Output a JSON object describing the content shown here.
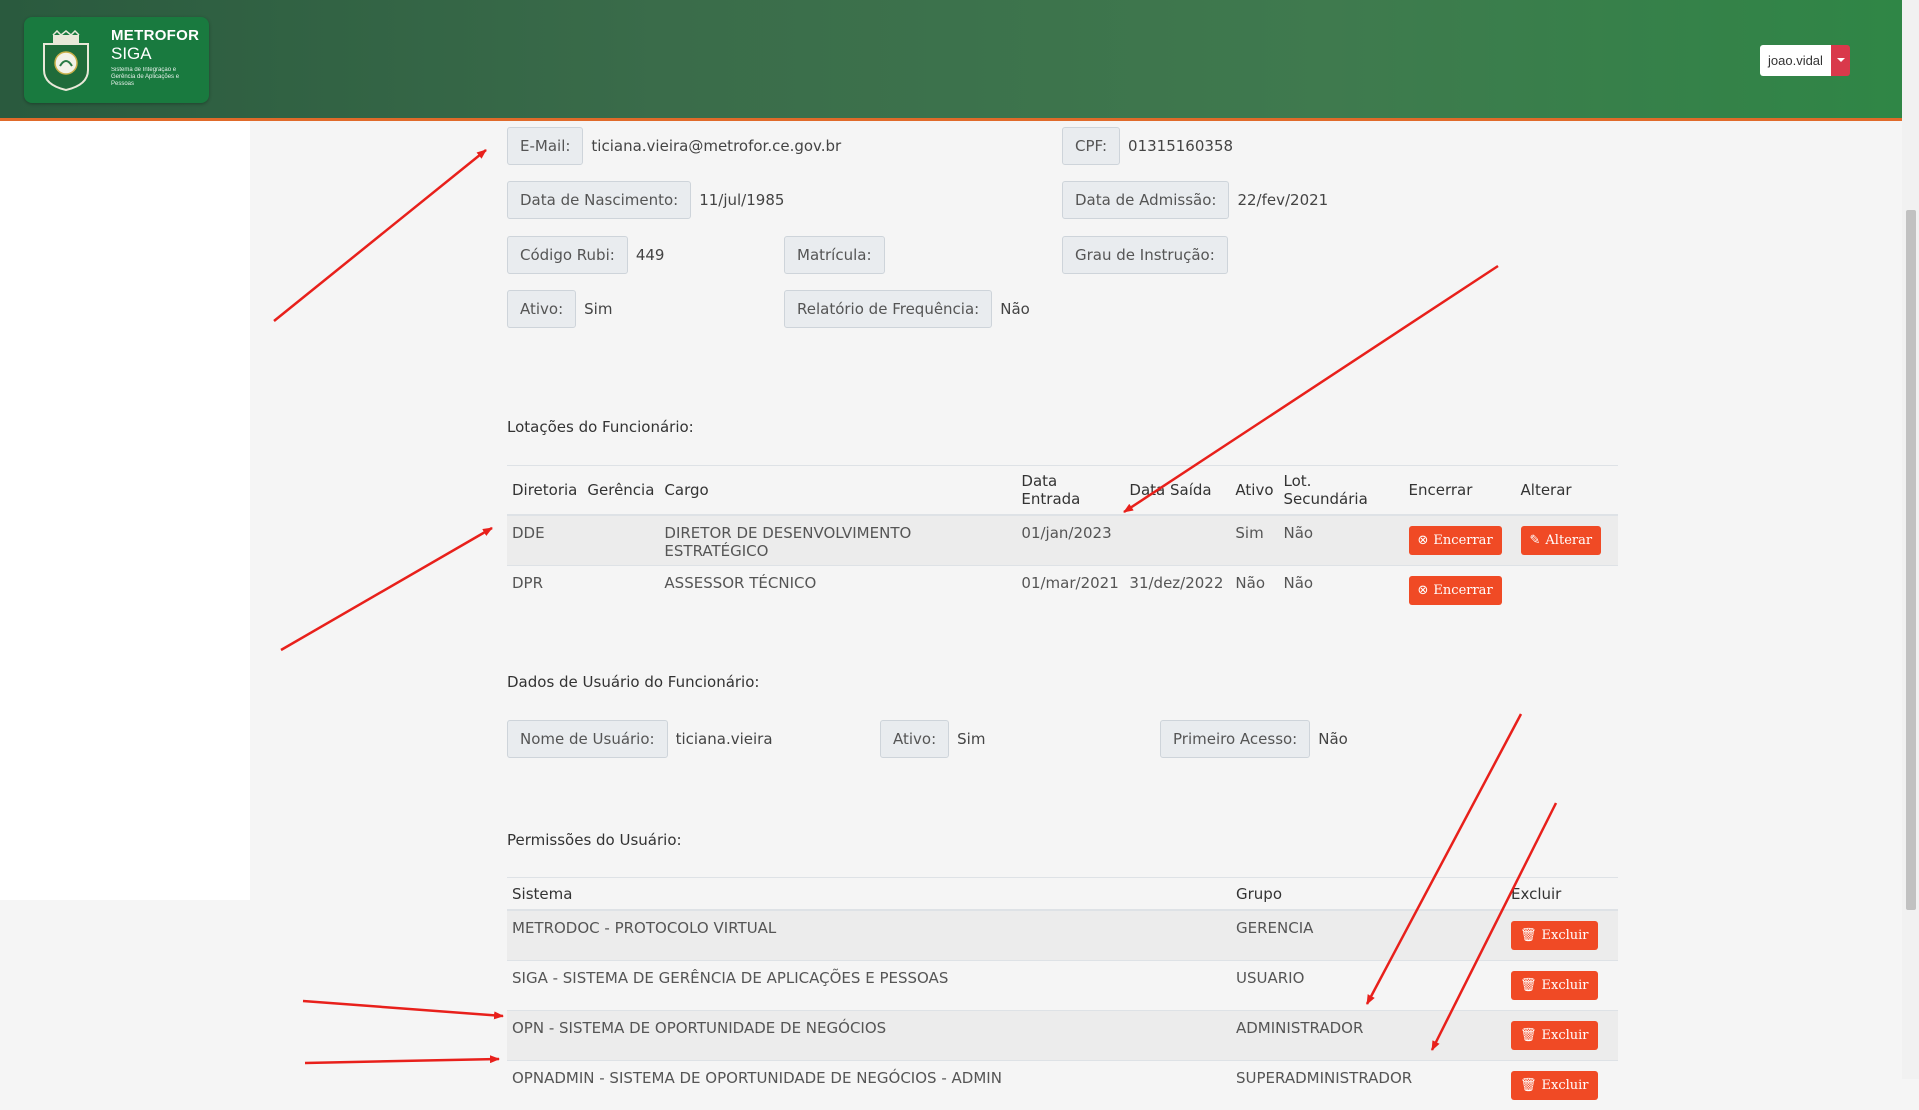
{
  "header": {
    "brand_title": "METROFOR",
    "brand_subtitle": "SIGA",
    "brand_tagline": "Sistema de Integração e Gerência de Aplicações e Pessoas",
    "user": "joao.vidal"
  },
  "profile": {
    "email_label": "E-Mail:",
    "email_value": "ticiana.vieira@metrofor.ce.gov.br",
    "cpf_label": "CPF:",
    "cpf_value": "01315160358",
    "birth_label": "Data de Nascimento:",
    "birth_value": "11/jul/1985",
    "admission_label": "Data de Admissão:",
    "admission_value": "22/fev/2021",
    "rubi_label": "Código Rubi:",
    "rubi_value": "449",
    "matricula_label": "Matrícula:",
    "instrucao_label": "Grau de Instrução:",
    "ativo_label": "Ativo:",
    "ativo_value": "Sim",
    "freq_label": "Relatório de Frequência:",
    "freq_value": "Não"
  },
  "lotacoes": {
    "title": "Lotações do Funcionário:",
    "headers": [
      "Diretoria",
      "Gerência",
      "Cargo",
      "Data Entrada",
      "Data Saída",
      "Ativo",
      "Lot. Secundária",
      "Encerrar",
      "Alterar"
    ],
    "rows": [
      {
        "diretoria": "DDE",
        "gerencia": "",
        "cargo": "DIRETOR DE DESENVOLVIMENTO ESTRATÉGICO",
        "entrada": "01/jan/2023",
        "saida": "",
        "ativo": "Sim",
        "secundaria": "Não",
        "encerrar": "Encerrar",
        "alterar": "Alterar"
      },
      {
        "diretoria": "DPR",
        "gerencia": "",
        "cargo": "ASSESSOR TÉCNICO",
        "entrada": "01/mar/2021",
        "saida": "31/dez/2022",
        "ativo": "Não",
        "secundaria": "Não",
        "encerrar": "Encerrar"
      }
    ]
  },
  "usuario": {
    "title": "Dados de Usuário do Funcionário:",
    "nome_label": "Nome de Usuário:",
    "nome_value": "ticiana.vieira",
    "ativo_label": "Ativo:",
    "ativo_value": "Sim",
    "primeiro_label": "Primeiro Acesso:",
    "primeiro_value": "Não"
  },
  "permissoes": {
    "title": "Permissões do Usuário:",
    "headers": [
      "Sistema",
      "Grupo",
      "Excluir"
    ],
    "rows": [
      {
        "sistema": "METRODOC - PROTOCOLO VIRTUAL",
        "grupo": "GERENCIA",
        "excluir": "Excluir"
      },
      {
        "sistema": "SIGA - SISTEMA DE GERÊNCIA DE APLICAÇÕES E PESSOAS",
        "grupo": "USUARIO",
        "excluir": "Excluir"
      },
      {
        "sistema": "OPN - SISTEMA DE OPORTUNIDADE DE NEGÓCIOS",
        "grupo": "ADMINISTRADOR",
        "excluir": "Excluir"
      },
      {
        "sistema": "OPNADMIN - SISTEMA DE OPORTUNIDADE DE NEGÓCIOS - ADMIN",
        "grupo": "SUPERADMINISTRADOR",
        "excluir": "Excluir"
      }
    ]
  },
  "icons": {
    "encerrar": "circle-x-icon",
    "alterar": "pencil-icon",
    "excluir": "trash-icon",
    "user_caret": "caret-down-icon"
  },
  "colors": {
    "header_green": "#2f6b45",
    "accent_orange": "#f04a25",
    "annotation_red": "#e8201b",
    "user_caret": "#d9394b"
  }
}
